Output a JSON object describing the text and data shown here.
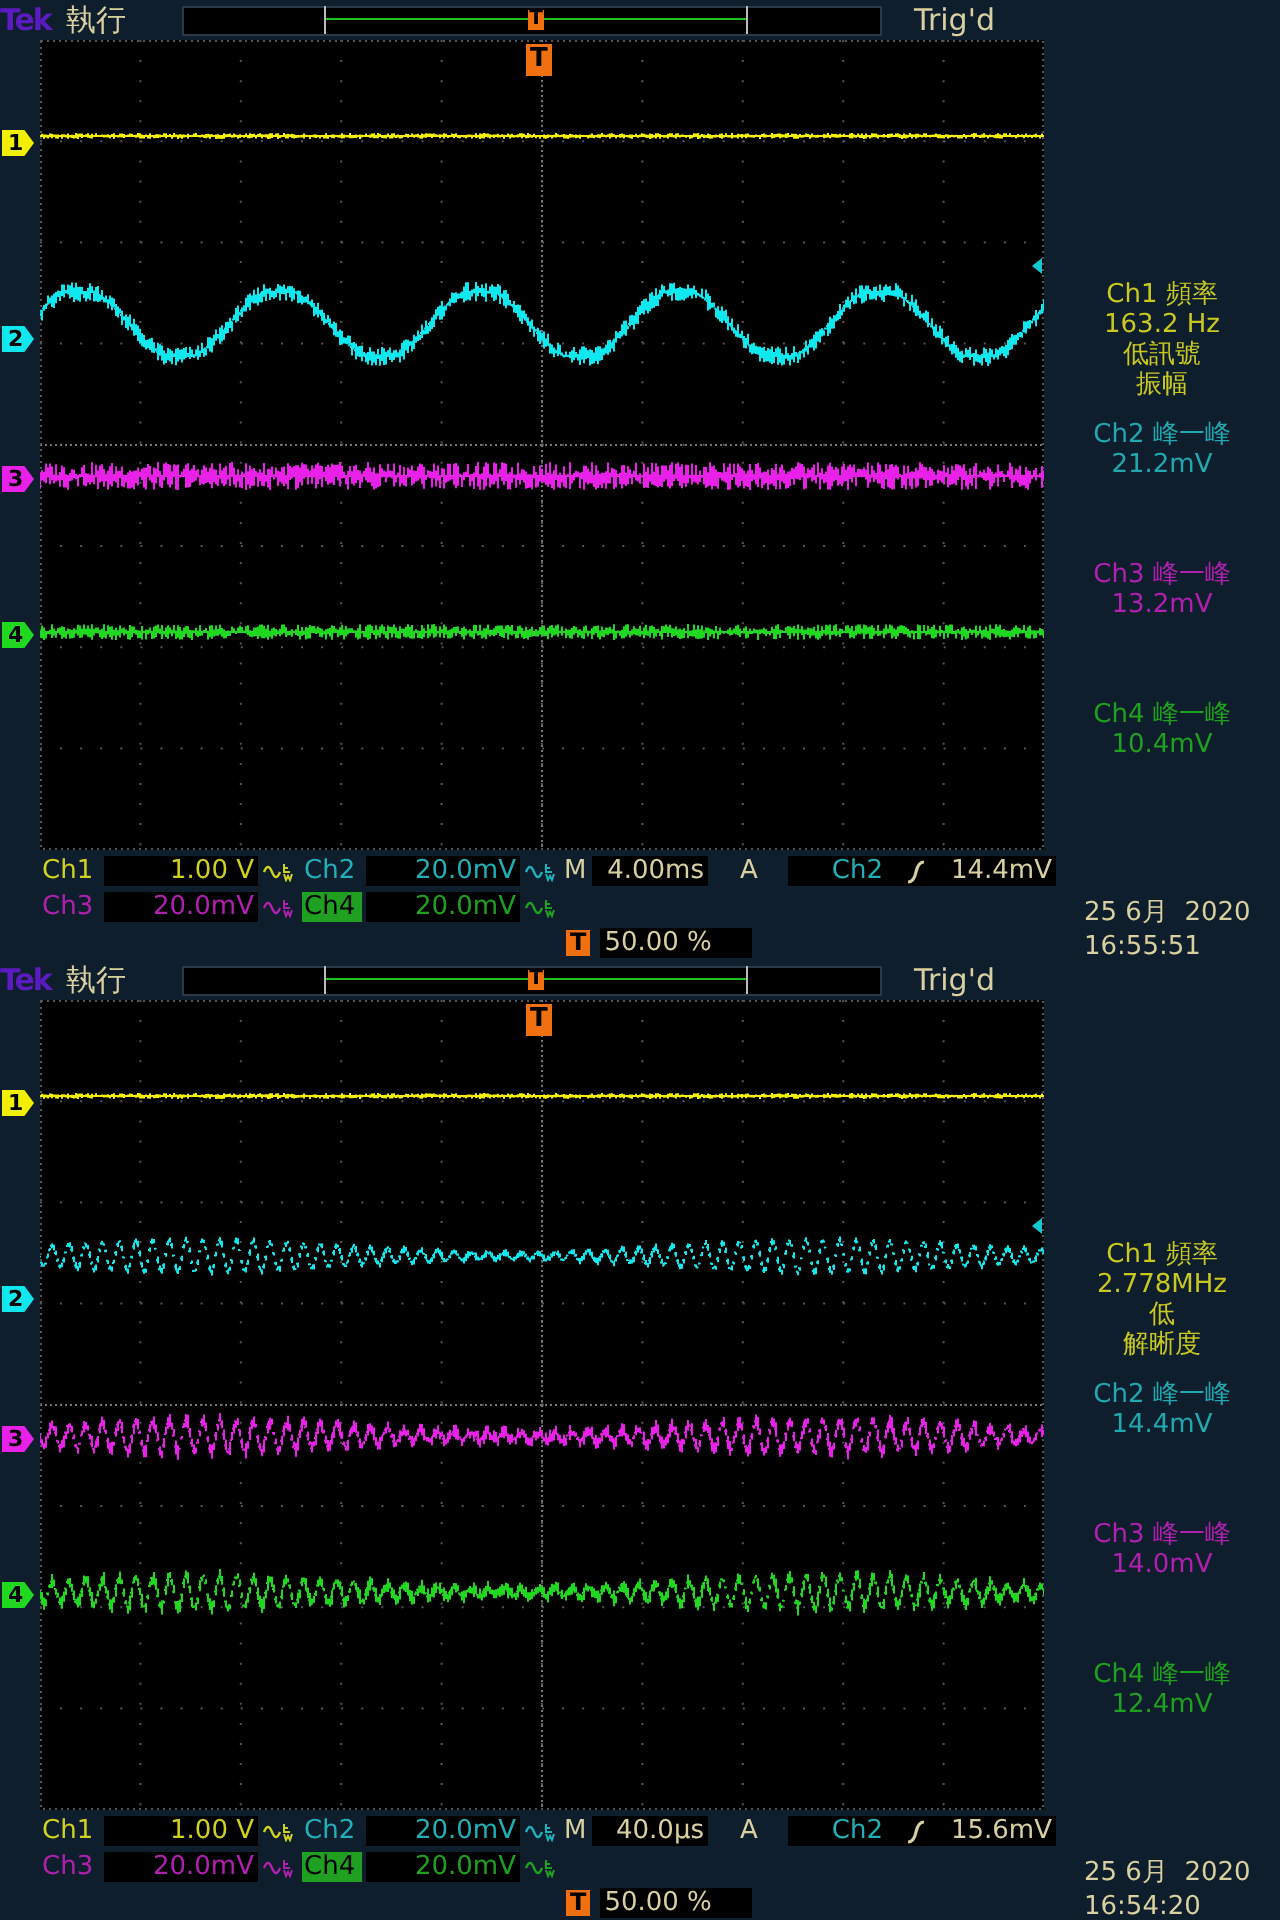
{
  "panels": [
    {
      "top_bar": {
        "brand": "Tek",
        "run_state": "執行",
        "record_marker": "T",
        "trigger_status": "Trig'd"
      },
      "trigger_marker": "T",
      "channels": [
        {
          "number": "1",
          "color": "#f0f000",
          "kind": "steady"
        },
        {
          "number": "2",
          "color": "#10e8f0",
          "kind": "sine"
        },
        {
          "number": "3",
          "color": "#e820e8",
          "kind": "noisy"
        },
        {
          "number": "4",
          "color": "#20d820",
          "kind": "noisy"
        }
      ],
      "measurements": [
        {
          "lines": [
            "Ch1 頻率",
            "163.2 Hz",
            "低訊號",
            "振幅"
          ],
          "color": "#c8c820"
        },
        {
          "lines": [
            "Ch2 峰一峰",
            "21.2mV"
          ],
          "color": "#20a8b0"
        },
        {
          "lines": [
            "Ch3 峰一峰",
            "13.2mV"
          ],
          "color": "#b020b0"
        },
        {
          "lines": [
            "Ch4 峰一峰",
            "10.4mV"
          ],
          "color": "#20a020"
        }
      ],
      "settings": {
        "channels": [
          {
            "label": "Ch1",
            "scale": "1.00 V",
            "bw_limit": true,
            "selected": false,
            "color": "#d0d020"
          },
          {
            "label": "Ch2",
            "scale": "20.0mV",
            "bw_limit": true,
            "selected": false,
            "color": "#20b0b8"
          },
          {
            "label": "Ch3",
            "scale": "20.0mV",
            "bw_limit": true,
            "selected": false,
            "color": "#b020b0"
          },
          {
            "label": "Ch4",
            "scale": "20.0mV",
            "bw_limit": true,
            "selected": true,
            "color": "#20a020"
          }
        ],
        "timebase": {
          "label": "M",
          "value": "4.00ms"
        },
        "trigger": {
          "label": "A",
          "source": "Ch2",
          "slope": {
            "kind": "rising"
          },
          "trigger_level": "14.4mV"
        },
        "trigger_position": {
          "marker": "T",
          "value": "50.00 %"
        },
        "date": "25 6月  2020",
        "time": "16:55:51"
      }
    },
    {
      "top_bar": {
        "brand": "Tek",
        "run_state": "執行",
        "record_marker": "T",
        "trigger_status": "Trig'd"
      },
      "trigger_marker": "T",
      "channels": [
        {
          "number": "1",
          "color": "#f0f000",
          "kind": "steady"
        },
        {
          "number": "2",
          "color": "#10e8f0",
          "kind": "ripple"
        },
        {
          "number": "3",
          "color": "#e820e8",
          "kind": "ripple"
        },
        {
          "number": "4",
          "color": "#20d820",
          "kind": "ripple"
        }
      ],
      "measurements": [
        {
          "lines": [
            "Ch1 頻率",
            "2.778MHz",
            "低",
            "解晰度"
          ],
          "color": "#c8c820"
        },
        {
          "lines": [
            "Ch2 峰一峰",
            "14.4mV"
          ],
          "color": "#20a8b0"
        },
        {
          "lines": [
            "Ch3 峰一峰",
            "14.0mV"
          ],
          "color": "#b020b0"
        },
        {
          "lines": [
            "Ch4 峰一峰",
            "12.4mV"
          ],
          "color": "#20a020"
        }
      ],
      "settings": {
        "channels": [
          {
            "label": "Ch1",
            "scale": "1.00 V",
            "bw_limit": true,
            "selected": false,
            "color": "#d0d020"
          },
          {
            "label": "Ch2",
            "scale": "20.0mV",
            "bw_limit": true,
            "selected": false,
            "color": "#20b0b8"
          },
          {
            "label": "Ch3",
            "scale": "20.0mV",
            "bw_limit": true,
            "selected": false,
            "color": "#b020b0"
          },
          {
            "label": "Ch4",
            "scale": "20.0mV",
            "bw_limit": true,
            "selected": true,
            "color": "#20a020"
          }
        ],
        "timebase": {
          "label": "M",
          "value": "40.0µs"
        },
        "trigger": {
          "label": "A",
          "source": "Ch2",
          "slope": {
            "kind": "rising"
          },
          "trigger_level": "15.6mV"
        },
        "trigger_position": {
          "marker": "T",
          "value": "50.00 %"
        },
        "date": "25 6月  2020",
        "time": "16:54:20"
      }
    }
  ]
}
